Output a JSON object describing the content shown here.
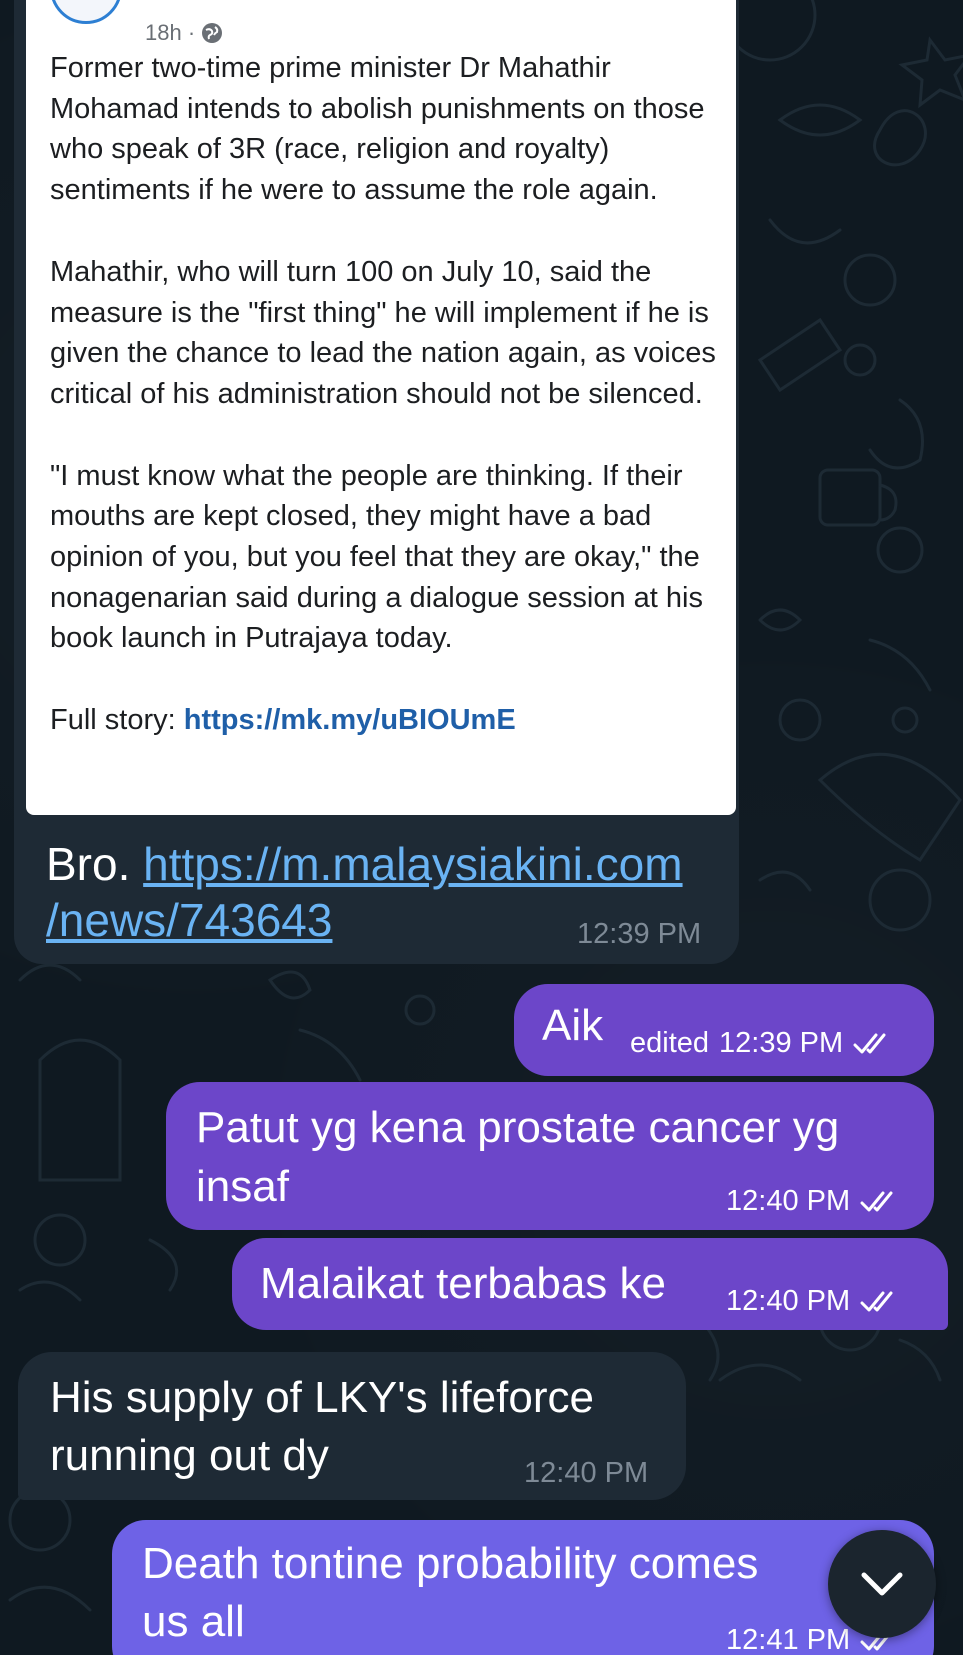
{
  "post": {
    "time_ago": "18h ·",
    "paragraphs": [
      "Former two-time prime minister Dr Mahathir Mohamad intends to abolish punishments on those who speak of 3R (race, religion and royalty) sentiments if he were to assume the role again.",
      "Mahathir, who will turn 100 on July 10, said the measure is the \"first thing\" he will implement if he is given the chance to lead the nation again, as voices critical of his administration should not be silenced.",
      "\"I must know what the people are thinking. If their mouths are kept closed, they might have a bad opinion of you, but you feel that they are okay,\" the nonagenarian said during a dialogue session at his book launch in Putrajaya today."
    ],
    "full_story_label": "Full story: ",
    "full_story_link": "https://mk.my/uBIOUmE"
  },
  "messages": [
    {
      "prefix": "Bro. ",
      "link_line1": "https://m.malaysiakini.com",
      "link_line2": "/news/743643",
      "time": "12:39 PM"
    },
    {
      "text": "Aik",
      "edited": "edited",
      "time": "12:39 PM"
    },
    {
      "line1": "Patut yg kena prostate cancer yg",
      "line2": "insaf",
      "time": "12:40 PM"
    },
    {
      "text": "Malaikat terbabas ke",
      "time": "12:40 PM"
    },
    {
      "line1": "His supply of LKY's lifeforce",
      "line2": "running out dy",
      "time": "12:40 PM"
    },
    {
      "line1": "Death tontine probability comes",
      "line2": "us all",
      "time": "12:41 PM"
    }
  ],
  "colors": {
    "background": "#0f1921",
    "incoming_bubble": "#1e2a35",
    "outgoing_bubble": "#6c46c9",
    "outgoing_bubble_last": "#6e62e6",
    "link": "#6ab3f3"
  },
  "icons": {
    "globe": "globe-icon",
    "read_receipt": "double-check-icon",
    "scroll_down": "chevron-down-icon"
  }
}
